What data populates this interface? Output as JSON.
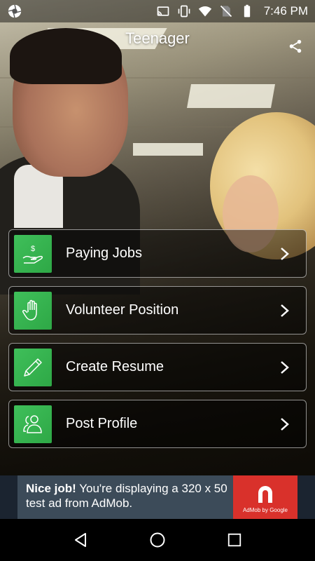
{
  "status_bar": {
    "time": "7:46 PM",
    "icons": [
      "aperture-icon",
      "cast-icon",
      "vibrate-icon",
      "wifi-icon",
      "no-sim-icon",
      "battery-icon"
    ]
  },
  "header": {
    "title": "Teenager",
    "share_icon": "share-icon"
  },
  "menu": {
    "items": [
      {
        "label": "Paying Jobs",
        "icon": "hand-dollar-icon"
      },
      {
        "label": "Volunteer Position",
        "icon": "raised-hand-icon"
      },
      {
        "label": "Create Resume",
        "icon": "pencil-icon"
      },
      {
        "label": "Post Profile",
        "icon": "profile-icon"
      }
    ],
    "accent_color": "#3fbf5a"
  },
  "ad": {
    "bold": "Nice job!",
    "text": " You're displaying a 320 x 50 test ad from AdMob.",
    "logo_text": "AdMob by Google",
    "logo_color": "#d9312b"
  },
  "nav": {
    "icons": [
      "back-icon",
      "home-icon",
      "recents-icon"
    ]
  }
}
